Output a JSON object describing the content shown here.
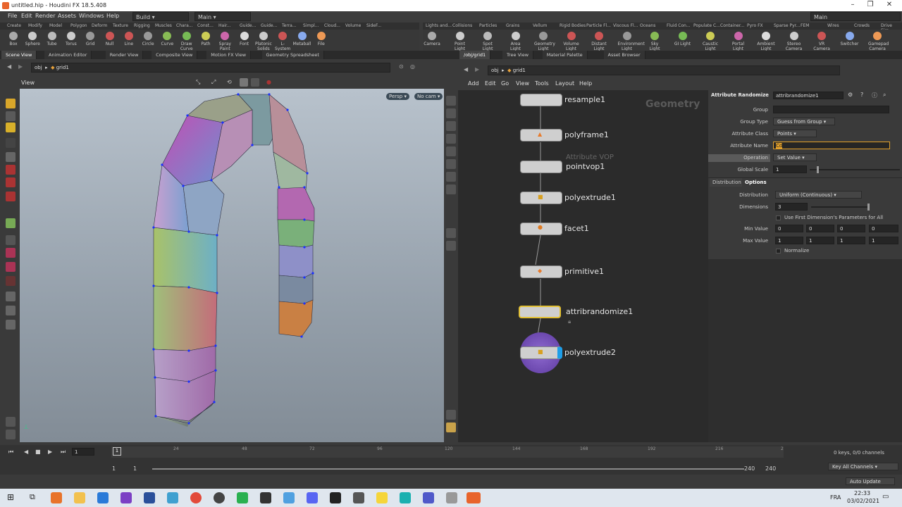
{
  "window": {
    "title": "untitled.hip - Houdini FX 18.5.408"
  },
  "menu": {
    "items": [
      "File",
      "Edit",
      "Render",
      "Assets",
      "Windows",
      "Help"
    ],
    "desktop": "Build",
    "desktop2": "Main",
    "desktop3": "Main"
  },
  "shelf_tabs_left": [
    "Create",
    "Modify",
    "Model",
    "Polygon",
    "Deform",
    "Texture",
    "Rigging",
    "Muscles",
    "Chara...",
    "Const...",
    "Hair...",
    "Guide...",
    "Guide...",
    "Terra...",
    "Simpl...",
    "Cloud...",
    "Volume",
    "SideF..."
  ],
  "shelf_tabs_right": [
    "Lights and...",
    "Collisions",
    "Particles",
    "Grains",
    "Vellum",
    "Rigid Bodies",
    "Particle Fl...",
    "Viscous Fl...",
    "Oceans",
    "Fluid Con...",
    "Populate C...",
    "Container...",
    "Pyro FX",
    "Sparse Pyr...",
    "FEM",
    "Wires",
    "Crowds",
    "Drive Sim..."
  ],
  "tools_left": [
    "Box",
    "Sphere",
    "Tube",
    "Torus",
    "Grid",
    "Null",
    "Line",
    "Circle",
    "Curve",
    "Draw Curve",
    "Path",
    "Spray Paint",
    "Font",
    "Platonic Solids",
    "L-System",
    "Metaball",
    "File"
  ],
  "tools_right": [
    "Camera",
    "Point Light",
    "Spot Light",
    "Area Light",
    "Geometry Light",
    "Volume Light",
    "Distant Light",
    "Environment Light",
    "Sky Light",
    "GI Light",
    "Caustic Light",
    "Portal Light",
    "Ambient Light",
    "Stereo Camera",
    "VR Camera",
    "Switcher",
    "Gamepad Camera"
  ],
  "pane_tabs_left": [
    "Scene View",
    "Animation Editor",
    "Render View",
    "Composite View",
    "Motion FX View",
    "Geometry Spreadsheet"
  ],
  "pane_tabs_right": [
    "/obj/grid1",
    "Tree View",
    "Material Palette",
    "Asset Browser"
  ],
  "path_left": {
    "obj": "obj",
    "node": "grid1"
  },
  "path_right": {
    "obj": "obj",
    "node": "grid1"
  },
  "viewport": {
    "label": "View",
    "persp": "Persp",
    "cam": "No cam"
  },
  "network": {
    "menu": [
      "Add",
      "Edit",
      "Go",
      "View",
      "Tools",
      "Layout",
      "Help"
    ],
    "context": "Geometry",
    "nodes": [
      {
        "name": "resample1"
      },
      {
        "name": "polyframe1"
      },
      {
        "name": "pointvop1",
        "sub": "Attribute VOP"
      },
      {
        "name": "polyextrude1"
      },
      {
        "name": "facet1"
      },
      {
        "name": "primitive1"
      },
      {
        "name": "attribrandomize1"
      },
      {
        "name": "polyextrude2"
      }
    ]
  },
  "params": {
    "type": "Attribute Randomize",
    "nodename": "attribrandomize1",
    "group_label": "Group",
    "group_value": "",
    "grouptype_label": "Group Type",
    "grouptype_value": "Guess from Group",
    "attrclass_label": "Attribute Class",
    "attrclass_value": "Points",
    "attrname_label": "Attribute Name",
    "attrname_value": "Cd",
    "operation_label": "Operation",
    "operation_value": "Set Value",
    "globalscale_label": "Global Scale",
    "globalscale_value": "1",
    "tab1": "Distribution",
    "tab2": "Options",
    "distribution_label": "Distribution",
    "distribution_value": "Uniform (Continuous)",
    "dimensions_label": "Dimensions",
    "dimensions_value": "3",
    "usefirst_label": "Use First Dimension's Parameters for All",
    "minvalue_label": "Min Value",
    "min": [
      "0",
      "0",
      "0",
      "0"
    ],
    "maxvalue_label": "Max Value",
    "max": [
      "1",
      "1",
      "1",
      "1"
    ],
    "normalize_label": "Normalize"
  },
  "timeline": {
    "frame": "1",
    "ticks": [
      "24",
      "48",
      "72",
      "96",
      "120",
      "144",
      "168",
      "192",
      "216",
      "2"
    ],
    "start": "1",
    "start2": "1",
    "end": "240",
    "end2": "240",
    "keys": "0 keys, 0/0 channels",
    "keyall": "Key All Channels",
    "autoupdate": "Auto Update"
  },
  "taskbar": {
    "lang": "FRA",
    "time": "22:33",
    "date": "03/02/2021"
  }
}
